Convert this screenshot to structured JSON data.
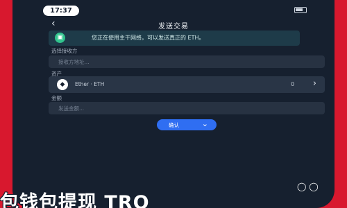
{
  "status_bar": {
    "time": "17:37"
  },
  "nav": {
    "title": "发送交易",
    "back_icon": "chevron-left-icon"
  },
  "banner": {
    "icon": "wallet-icon",
    "text": "您正在使用主干网络，可以发送真正的 ETH。"
  },
  "recipient": {
    "label": "选择接收方",
    "placeholder": "接收方地址..."
  },
  "asset": {
    "label": "资产",
    "icon": "ethereum-icon",
    "name": "Ether · ETH",
    "value": "0"
  },
  "amount": {
    "label": "金额",
    "placeholder": "发送金额..."
  },
  "confirm": {
    "label": "确认"
  },
  "caption": {
    "text": "包钱包提现 TRO"
  },
  "colors": {
    "screen_bg": "#16202f",
    "frame": "#d8182e",
    "banner_bg": "#1e3b49",
    "primary": "#2f6ef2",
    "success": "#31c48d"
  }
}
